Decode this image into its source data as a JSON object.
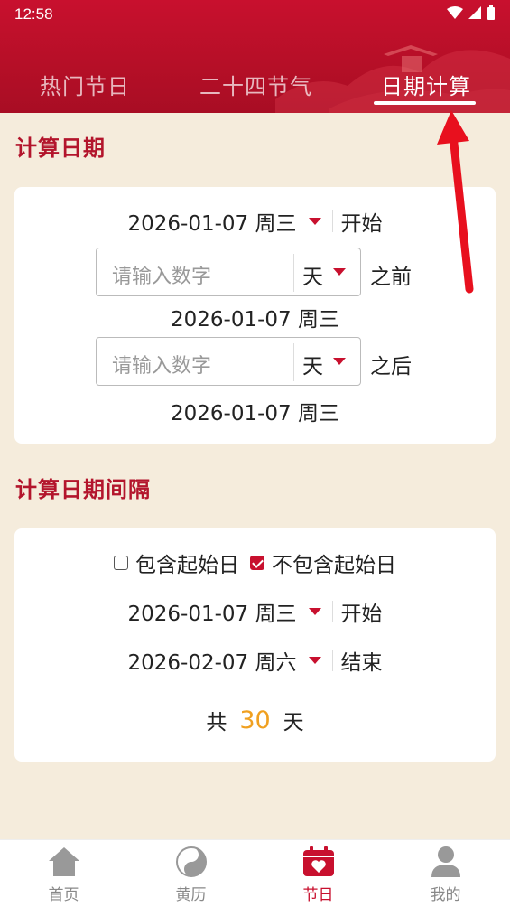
{
  "status_bar": {
    "time": "12:58"
  },
  "tabs": [
    {
      "label": "热门节日",
      "active": false
    },
    {
      "label": "二十四节气",
      "active": false
    },
    {
      "label": "日期计算",
      "active": true
    }
  ],
  "calc_date": {
    "title": "计算日期",
    "start_date": "2026-01-07 周三",
    "start_label": "开始",
    "before_input": {
      "placeholder": "请输入数字",
      "unit": "天",
      "label": "之前"
    },
    "before_result": "2026-01-07 周三",
    "after_input": {
      "placeholder": "请输入数字",
      "unit": "天",
      "label": "之后"
    },
    "after_result": "2026-01-07 周三"
  },
  "calc_interval": {
    "title": "计算日期间隔",
    "include_start": {
      "label": "包含起始日",
      "checked": false
    },
    "exclude_start": {
      "label": "不包含起始日",
      "checked": true
    },
    "start_date": "2026-01-07 周三",
    "start_label": "开始",
    "end_date": "2026-02-07 周六",
    "end_label": "结束",
    "total_prefix": "共",
    "total_days": "30",
    "total_suffix": "天"
  },
  "bottom_nav": [
    {
      "label": "首页",
      "icon": "home-icon",
      "active": false
    },
    {
      "label": "黄历",
      "icon": "yinyang-icon",
      "active": false
    },
    {
      "label": "节日",
      "icon": "calendar-heart-icon",
      "active": true
    },
    {
      "label": "我的",
      "icon": "person-icon",
      "active": false
    }
  ],
  "colors": {
    "primary": "#c8102e",
    "accent": "#f0a020",
    "background": "#f5ecdc"
  }
}
